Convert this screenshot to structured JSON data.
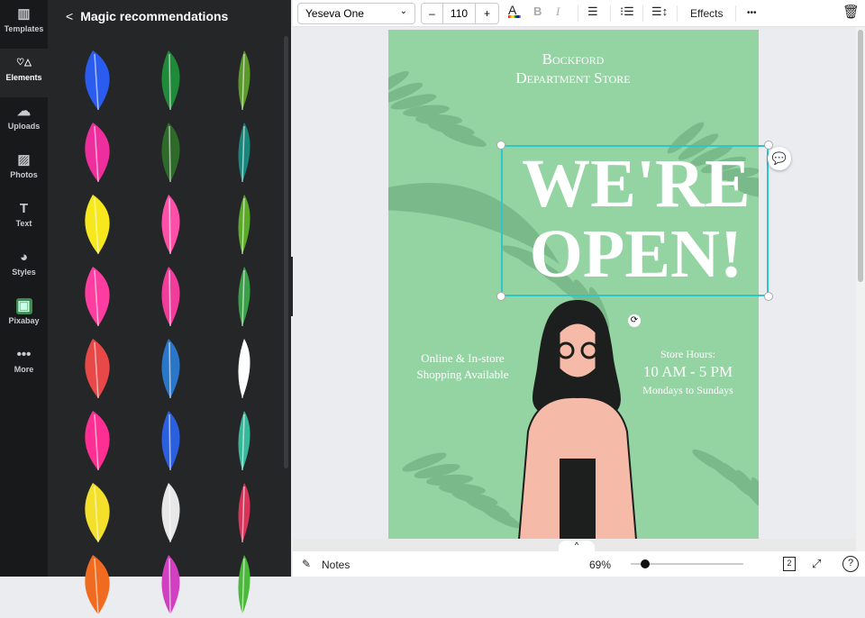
{
  "rail": [
    {
      "label": "Templates",
      "icon": "templates-icon"
    },
    {
      "label": "Elements",
      "icon": "elements-icon"
    },
    {
      "label": "Uploads",
      "icon": "upload-icon"
    },
    {
      "label": "Photos",
      "icon": "photos-icon"
    },
    {
      "label": "Text",
      "icon": "text-icon"
    },
    {
      "label": "Styles",
      "icon": "palette-icon"
    },
    {
      "label": "Pixabay",
      "icon": "pixabay-icon"
    },
    {
      "label": "More",
      "icon": "more-icon"
    }
  ],
  "panel": {
    "title": "Magic recommendations",
    "thumb_colors": [
      "#2a5cf0",
      "#1f8a3a",
      "#5a9a2a",
      "#ee2e9c",
      "#2e6b2a",
      "#18867a",
      "#f6e81c",
      "#ff4fa8",
      "#5aaa28",
      "#ff3ca0",
      "#f23c9c",
      "#3aa048",
      "#e84848",
      "#2a76c8",
      "#ffffff",
      "#ff2e92",
      "#2a60e0",
      "#36b89a",
      "#f4e02a",
      "#e8e8e8",
      "#d8345a",
      "#f06a20",
      "#d040c0",
      "#4ab838"
    ]
  },
  "toolbar": {
    "font": "Yeseva One",
    "minus": "–",
    "size": "110",
    "plus": "+",
    "effects": "Effects",
    "more": "•••"
  },
  "design": {
    "store_line1": "Bockford",
    "store_line2": "Department Store",
    "headline1": "WE'RE",
    "headline2": "OPEN!",
    "left_line1": "Online & In-store",
    "left_line2": "Shopping Available",
    "hours_label": "Store Hours:",
    "hours": "10 AM - 5 PM",
    "days": "Mondays to Sundays"
  },
  "bottom": {
    "notes": "Notes",
    "zoom": "69%",
    "zoom_fraction": 0.06,
    "pages": "2"
  },
  "colors": {
    "canvas": "#94d3a2",
    "selection": "#2cc6cc"
  }
}
